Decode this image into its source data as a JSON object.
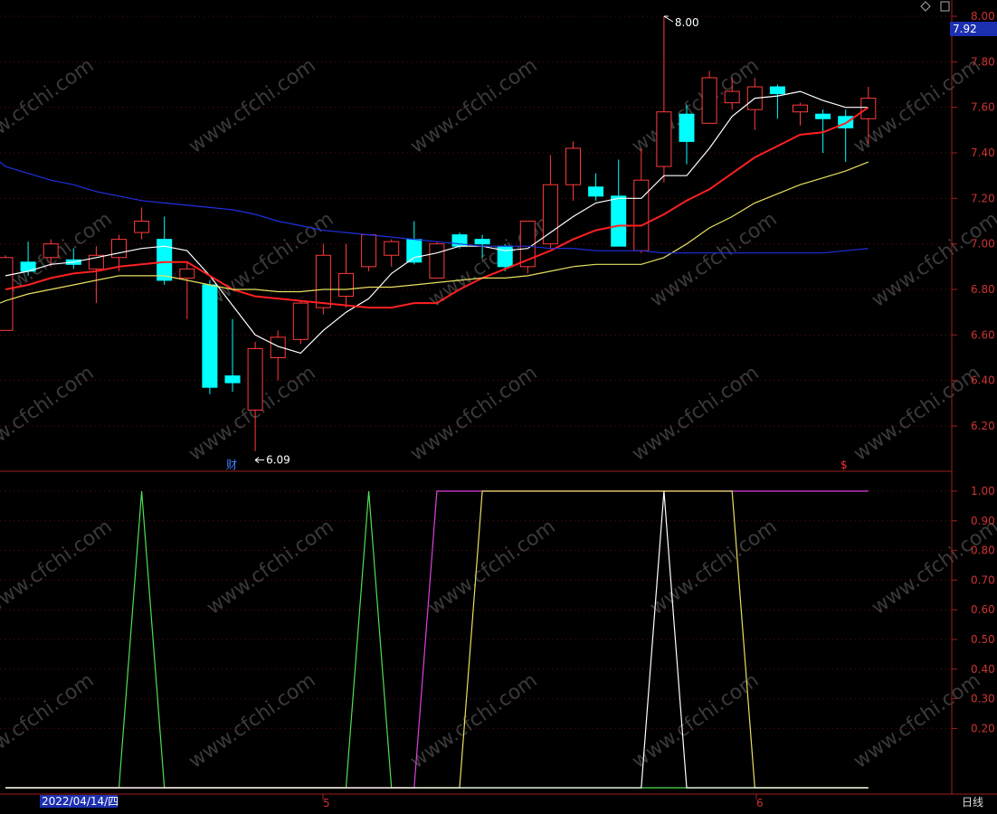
{
  "chart_data": [
    {
      "type": "candlestick",
      "price_axis": {
        "ticks": [
          "8.00",
          "7.80",
          "7.60",
          "7.40",
          "7.20",
          "7.00",
          "6.80",
          "6.60",
          "6.40",
          "6.20"
        ],
        "ylim": [
          6.0,
          8.05
        ],
        "current_price": "7.92"
      },
      "candles": [
        {
          "o": 6.62,
          "c": 6.94,
          "h": 6.95,
          "l": 6.62
        },
        {
          "o": 6.92,
          "c": 6.88,
          "h": 7.01,
          "l": 6.86
        },
        {
          "o": 6.94,
          "c": 7.0,
          "h": 7.02,
          "l": 6.9
        },
        {
          "o": 6.93,
          "c": 6.91,
          "h": 6.98,
          "l": 6.89
        },
        {
          "o": 6.89,
          "c": 6.95,
          "h": 6.99,
          "l": 6.74
        },
        {
          "o": 6.94,
          "c": 7.02,
          "h": 7.04,
          "l": 6.88
        },
        {
          "o": 7.05,
          "c": 7.1,
          "h": 7.16,
          "l": 7.02
        },
        {
          "o": 7.02,
          "c": 6.84,
          "h": 7.12,
          "l": 6.82
        },
        {
          "o": 6.85,
          "c": 6.89,
          "h": 6.92,
          "l": 6.67
        },
        {
          "o": 6.82,
          "c": 6.37,
          "h": 6.84,
          "l": 6.34
        },
        {
          "o": 6.42,
          "c": 6.39,
          "h": 6.67,
          "l": 6.35
        },
        {
          "o": 6.27,
          "c": 6.54,
          "h": 6.57,
          "l": 6.09
        },
        {
          "o": 6.5,
          "c": 6.59,
          "h": 6.62,
          "l": 6.4
        },
        {
          "o": 6.58,
          "c": 6.74,
          "h": 6.75,
          "l": 6.56
        },
        {
          "o": 6.72,
          "c": 6.95,
          "h": 7.0,
          "l": 6.69
        },
        {
          "o": 6.77,
          "c": 6.87,
          "h": 7.0,
          "l": 6.72
        },
        {
          "o": 6.9,
          "c": 7.04,
          "h": 7.04,
          "l": 6.88
        },
        {
          "o": 6.95,
          "c": 7.01,
          "h": 7.02,
          "l": 6.9
        },
        {
          "o": 7.02,
          "c": 6.92,
          "h": 7.1,
          "l": 6.91
        },
        {
          "o": 6.85,
          "c": 7.0,
          "h": 7.01,
          "l": 6.85
        },
        {
          "o": 7.04,
          "c": 6.99,
          "h": 7.05,
          "l": 6.98
        },
        {
          "o": 7.02,
          "c": 7.0,
          "h": 7.04,
          "l": 6.94
        },
        {
          "o": 6.99,
          "c": 6.9,
          "h": 7.0,
          "l": 6.88
        },
        {
          "o": 6.9,
          "c": 7.1,
          "h": 7.1,
          "l": 6.87
        },
        {
          "o": 7.0,
          "c": 7.26,
          "h": 7.39,
          "l": 6.98
        },
        {
          "o": 7.26,
          "c": 7.42,
          "h": 7.45,
          "l": 7.19
        },
        {
          "o": 7.25,
          "c": 7.21,
          "h": 7.31,
          "l": 7.19
        },
        {
          "o": 7.21,
          "c": 6.99,
          "h": 7.37,
          "l": 6.99
        },
        {
          "o": 6.97,
          "c": 7.28,
          "h": 7.42,
          "l": 6.96
        },
        {
          "o": 7.34,
          "c": 7.58,
          "h": 8.0,
          "l": 7.27
        },
        {
          "o": 7.57,
          "c": 7.45,
          "h": 7.61,
          "l": 7.35
        },
        {
          "o": 7.53,
          "c": 7.73,
          "h": 7.76,
          "l": 7.53
        },
        {
          "o": 7.62,
          "c": 7.67,
          "h": 7.73,
          "l": 7.59
        },
        {
          "o": 7.59,
          "c": 7.69,
          "h": 7.73,
          "l": 7.5
        },
        {
          "o": 7.69,
          "c": 7.66,
          "h": 7.7,
          "l": 7.55
        },
        {
          "o": 7.58,
          "c": 7.61,
          "h": 7.62,
          "l": 7.52
        },
        {
          "o": 7.57,
          "c": 7.55,
          "h": 7.59,
          "l": 7.4
        },
        {
          "o": 7.56,
          "c": 7.51,
          "h": 7.59,
          "l": 7.36
        },
        {
          "o": 7.55,
          "c": 7.64,
          "h": 7.69,
          "l": 7.44
        }
      ],
      "moving_averages": [
        {
          "color": "#ffffff",
          "values": [
            6.86,
            6.88,
            6.91,
            6.92,
            6.94,
            6.96,
            6.98,
            6.99,
            6.97,
            6.86,
            6.73,
            6.6,
            6.55,
            6.52,
            6.62,
            6.7,
            6.76,
            6.87,
            6.94,
            6.96,
            6.99,
            6.99,
            6.97,
            6.98,
            7.05,
            7.12,
            7.18,
            7.2,
            7.2,
            7.3,
            7.3,
            7.42,
            7.56,
            7.64,
            7.65,
            7.67,
            7.63,
            7.6,
            7.6
          ]
        },
        {
          "color": "#ff2020",
          "values": [
            6.8,
            6.82,
            6.85,
            6.87,
            6.88,
            6.9,
            6.91,
            6.92,
            6.92,
            6.86,
            6.8,
            6.77,
            6.76,
            6.75,
            6.74,
            6.73,
            6.72,
            6.72,
            6.74,
            6.74,
            6.8,
            6.85,
            6.89,
            6.93,
            6.97,
            7.02,
            7.06,
            7.08,
            7.08,
            7.13,
            7.19,
            7.24,
            7.31,
            7.38,
            7.43,
            7.48,
            7.49,
            7.53,
            7.6
          ]
        },
        {
          "color": "#e8e060",
          "values": [
            6.74,
            6.75,
            6.78,
            6.8,
            6.82,
            6.84,
            6.86,
            6.86,
            6.86,
            6.84,
            6.82,
            6.8,
            6.8,
            6.79,
            6.79,
            6.8,
            6.8,
            6.81,
            6.81,
            6.82,
            6.83,
            6.84,
            6.85,
            6.85,
            6.86,
            6.88,
            6.9,
            6.91,
            6.91,
            6.91,
            6.94,
            7.0,
            7.07,
            7.12,
            7.18,
            7.22,
            7.26,
            7.29,
            7.32,
            7.36
          ]
        },
        {
          "color": "#2030e0",
          "values": [
            7.36,
            7.34,
            7.31,
            7.28,
            7.26,
            7.23,
            7.21,
            7.19,
            7.18,
            7.17,
            7.16,
            7.15,
            7.13,
            7.1,
            7.08,
            7.06,
            7.05,
            7.04,
            7.03,
            7.02,
            7.01,
            7.0,
            6.99,
            6.99,
            6.99,
            6.98,
            6.98,
            6.97,
            6.97,
            6.97,
            6.96,
            6.96,
            6.96,
            6.96,
            6.96,
            6.96,
            6.96,
            6.96,
            6.97,
            6.98
          ]
        }
      ],
      "annotations": [
        {
          "text": "8.00",
          "color": "#ffffff",
          "at_price": 8.0
        },
        {
          "text": "6.09",
          "color": "#ffffff",
          "at_price": 6.09
        },
        {
          "text": "财",
          "color": "#4080ff"
        },
        {
          "text": "$",
          "color": "#ff3030"
        }
      ]
    },
    {
      "type": "line",
      "axis_ticks": [
        "1.00",
        "0.90",
        "0.80",
        "0.70",
        "0.60",
        "0.50",
        "0.40",
        "0.30",
        "0.20"
      ],
      "ylim": [
        -0.08,
        1.0
      ],
      "series": [
        {
          "color": "#50e050",
          "values": [
            0,
            0,
            0,
            0,
            0,
            0,
            1,
            0,
            0,
            0,
            0,
            0,
            0,
            0,
            0,
            0,
            1,
            0,
            0,
            0,
            0,
            0,
            0,
            0,
            0,
            0,
            0,
            0,
            0,
            0,
            0,
            0,
            0,
            0,
            0,
            0,
            0,
            0,
            0
          ]
        },
        {
          "color": "#e040e0",
          "values": [
            0,
            0,
            0,
            0,
            0,
            0,
            0,
            0,
            0,
            0,
            0,
            0,
            0,
            0,
            0,
            0,
            0,
            0,
            0,
            1,
            1,
            1,
            1,
            1,
            1,
            1,
            1,
            1,
            1,
            1,
            1,
            1,
            1,
            1,
            1,
            1,
            1,
            1,
            1
          ]
        },
        {
          "color": "#e8e060",
          "values": [
            0,
            0,
            0,
            0,
            0,
            0,
            0,
            0,
            0,
            0,
            0,
            0,
            0,
            0,
            0,
            0,
            0,
            0,
            0,
            0,
            0,
            1,
            1,
            1,
            1,
            1,
            1,
            1,
            1,
            1,
            1,
            1,
            1,
            0,
            0,
            0,
            0,
            0,
            0
          ]
        },
        {
          "color": "#ffffff",
          "values": [
            0,
            0,
            0,
            0,
            0,
            0,
            0,
            0,
            0,
            0,
            0,
            0,
            0,
            0,
            0,
            0,
            0,
            0,
            0,
            0,
            0,
            0,
            0,
            0,
            0,
            0,
            0,
            0,
            0,
            1,
            0,
            0,
            0,
            0,
            0,
            0,
            0,
            0,
            0
          ]
        }
      ]
    }
  ],
  "x_axis": {
    "date_label": "2022/04/14/四",
    "month_labels": [
      "5",
      "6"
    ]
  },
  "period_label": "日线",
  "watermark": "www.cfchi.com"
}
